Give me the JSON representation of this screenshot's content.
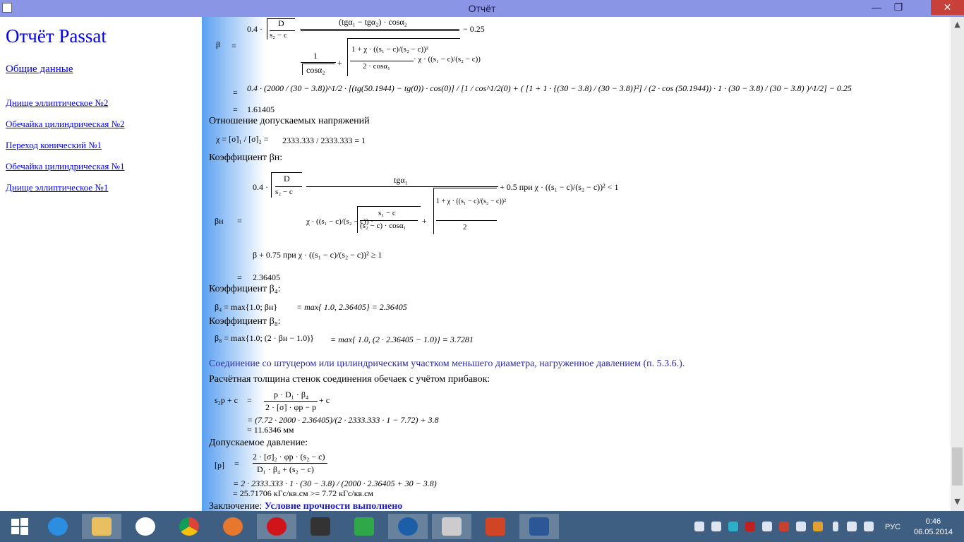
{
  "window": {
    "title": "Отчёт"
  },
  "sidebar": {
    "heading": "Отчёт Passat",
    "general": "Общие данные",
    "links": [
      "Днище эллиптическое №2",
      "Обечайка цилиндрическая №2",
      "Переход конический №1",
      "Обечайка цилиндрическая №1",
      "Днище эллиптическое №1"
    ]
  },
  "main": {
    "beta": {
      "sym": "β",
      "eq": "=",
      "coef": "0.4 ·",
      "D": "D",
      "s2c": "s₂ − c",
      "num": "(tgα₁ − tgα₂) · cosα₂",
      "minus": "− 0.25",
      "one": "1",
      "sqcos": "cosα₂",
      "plus": "+",
      "inner_top": "1 + χ · ((s₁ − c)/(s₂ − c))²",
      "inner_bot": "2 · cosα₁",
      "chi_frac": "· χ · ((s₁ − c)/(s₂ − c))",
      "subst": "0.4 · (2000 / (30 − 3.8))^1/2 · [(tg(50.1944) − tg(0)) · cos(0)] / [1 / cos^1/2(0) + ( [1 + 1 · {(30 − 3.8) / (30 − 3.8)}²] / (2 · cos (50.1944)) · 1 · (30 − 3.8) / (30 − 3.8) )^1/2] − 0.25",
      "result": "1.61405"
    },
    "ratio": {
      "label": "Отношение допускаемых напряжений",
      "formula": "χ = [σ]₁ / [σ]₂ =",
      "value": "2333.333 / 2333.333 = 1"
    },
    "betaH": {
      "label": "Коэффициент βн:",
      "sym": "βн",
      "eq": "=",
      "coef": "0.4 ·",
      "D": "D",
      "s2c": "s₂ − c",
      "num": "tgα₁",
      "tail": "+ 0.5    при    χ · ((s₁ − c)/(s₂ − c))² < 1",
      "den_left": "χ · ((s₁ − c)/(s₂ − c)) ·",
      "den_mid_top": "s₁ − c",
      "den_mid_bot": "(s₂ − c) · cosα₁",
      "den_plus": "+",
      "den_right_top": "1 + χ · ((s₁ − c)/(s₂ − c))²",
      "den_right_bot": "2",
      "alt": "β + 0.75    при    χ · ((s₁ − c)/(s₂ − c))² ≥ 1",
      "result": "2.36405"
    },
    "beta4": {
      "label": "Коэффициент β₄:",
      "formula": "β₄ = max{1.0; βн}",
      "value": "= max{ 1.0, 2.36405} = 2.36405"
    },
    "beta8": {
      "label": "Коэффициент β₈:",
      "formula": "β₈ = max{1.0; (2 · βн − 1.0)}",
      "value": "= max{ 1.0, (2 · 2.36405 − 1.0)} = 3.7281"
    },
    "section": "Соединение со штуцером или цилиндрическим участком меньшего диаметра, нагруженное давлением (п. 5.3.6.).",
    "thick": {
      "label": "Расчётная толщина стенок соединения обечаек с учётом прибавок:",
      "lhs": "s₂р + c",
      "eq": "=",
      "num": "p · D₁ · β₄",
      "den": "2 · [σ] · φр − p",
      "plus": "+ c",
      "subst": "=    (7.72 · 2000 · 2.36405)/(2 · 2333.333 · 1 − 7.72) + 3.8",
      "result": "=    11.6346 мм"
    },
    "press": {
      "label": "Допускаемое давление:",
      "lhs": "[p]",
      "eq": "=",
      "num": "2 · [σ]₂ · φр · (s₂ − c)",
      "den": "D₁ · β₄ + (s₂ − c)",
      "subst": "=    2 · 2333.333 · 1 · (30 − 3.8) / (2000 · 2.36405 + 30 − 3.8)",
      "result": "=    25.71706 кГс/кв.см >= 7.72 кГс/кв.см"
    },
    "conclusion": {
      "label": "Заключение: ",
      "value": "Условие прочности выполнено"
    }
  },
  "taskbar": {
    "lang": "РУС",
    "time": "0:46",
    "date": "06.05.2014"
  }
}
